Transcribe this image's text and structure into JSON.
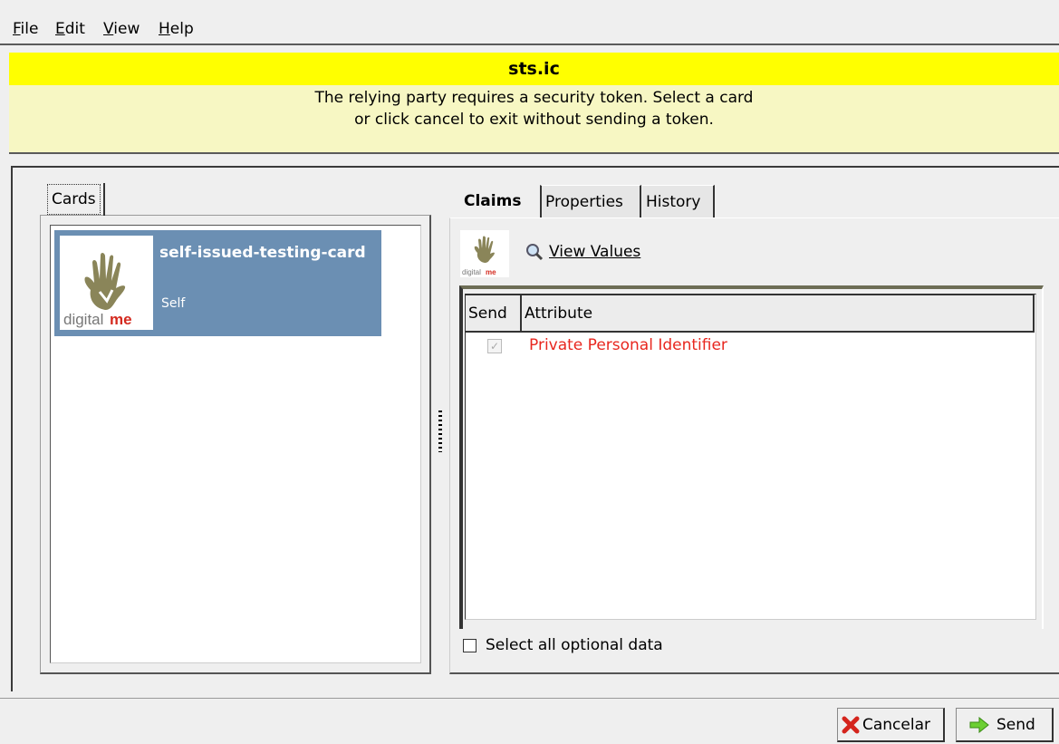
{
  "menu": {
    "file": "File",
    "edit": "Edit",
    "view": "View",
    "help": "Help"
  },
  "banner": {
    "title": "sts.ic",
    "message": "The relying party requires a security token.  Select a card or click cancel to exit without sending a token."
  },
  "cards_panel": {
    "tab_label": "Cards",
    "card": {
      "name": "self-issued-testing-card",
      "type": "Self",
      "logo_text_a": "digital",
      "logo_text_b": "me"
    }
  },
  "details_panel": {
    "tabs": [
      "Claims",
      "Properties",
      "History"
    ],
    "view_values": "View Values",
    "table": {
      "headers": [
        "Send",
        "Attribute"
      ],
      "rows": [
        {
          "send_checked": true,
          "attribute": "Private Personal Identifier"
        }
      ]
    },
    "select_all_label": "Select all optional data"
  },
  "buttons": {
    "cancel": "Cancelar",
    "send": "Send"
  },
  "colors": {
    "banner_title_bg": "#ffff00",
    "banner_msg_bg": "#f7f7c3",
    "card_selected_bg": "#6b8fb3",
    "required_attr": "#e8271f"
  }
}
